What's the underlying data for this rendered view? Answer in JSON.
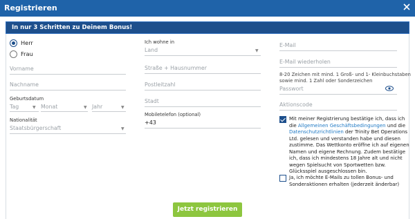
{
  "window": {
    "title": "Registrieren"
  },
  "promo": {
    "text": "In nur 3 Schritten zu Deinem Bonus!"
  },
  "col1": {
    "salutation": {
      "options": [
        "Herr",
        "Frau"
      ],
      "selected": "Herr"
    },
    "first_name_placeholder": "Vorname",
    "last_name_placeholder": "Nachname",
    "birth_label": "Geburtsdatum",
    "day_placeholder": "Tag",
    "month_placeholder": "Monat",
    "year_placeholder": "Jahr",
    "nationality_label": "Nationalität",
    "nationality_placeholder": "Staatsbürgerschaft"
  },
  "col2": {
    "residence_label": "Ich wohne in",
    "country_placeholder": "Land",
    "street_placeholder": "Straße + Hausnummer",
    "postal_placeholder": "Postleitzahl",
    "city_placeholder": "Stadt",
    "mobile_label": "Mobiletelefon (optional)",
    "mobile_prefix": "+43"
  },
  "col3": {
    "email_placeholder": "E-Mail",
    "email_repeat_placeholder": "E-Mail wiederholen",
    "password_hint_line1": "8-20 Zeichen mit mind. 1 Groß- und 1- Kleinbuchstaben",
    "password_hint_line2": "sowie mind. 1 Zahl oder Sonderzeichen",
    "password_placeholder": "Passwort",
    "promo_code_placeholder": "Aktionscode",
    "terms": {
      "checked": true,
      "pre": "Mit meiner Registrierung bestätige ich, dass ich die ",
      "link1": "Allgemeinen Geschäftsbedingungen",
      "mid": " und die ",
      "link2": "Datenschutzrichtlinien",
      "post": " der Trinity Bet Operations Ltd. gelesen und verstanden habe und diesen zustimme. Das Wettkonto eröffne ich auf eigenen Namen und eigene Rechnung. Zudem bestätige ich, dass ich mindestens 18 Jahre alt und nicht wegen Spielsucht von Sportwetten bzw. Glücksspiel ausgeschlossen bin."
    },
    "newsletter": {
      "checked": false,
      "text": "Ja, ich möchte E-Mails zu tollen Bonus- und Sonderaktionen erhalten (jederzeit änderbar)"
    }
  },
  "submit_label": "Jetzt registrieren",
  "colors": {
    "header": "#1f63a9",
    "promo": "#1d4f8c",
    "submit": "#8dc63f",
    "link": "#1f79c4"
  }
}
